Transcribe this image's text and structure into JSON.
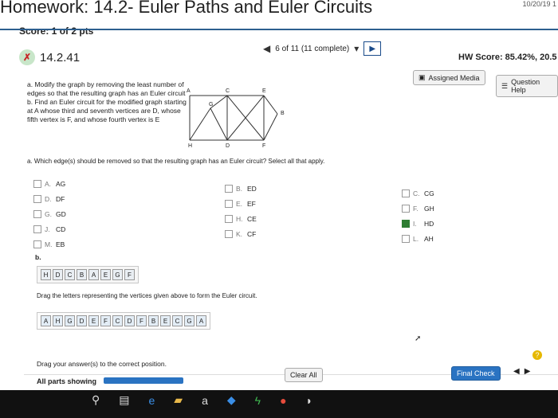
{
  "title": "Homework: 14.2- Euler Paths and Euler Circuits",
  "corner_date": "10/20/19 1",
  "score": "Score: 1 of 2 pts",
  "nav": {
    "progress_text": "6 of 11 (11 complete)",
    "prev_label": "◀",
    "next_label": "▶"
  },
  "question_number": "14.2.41",
  "hw_score": "HW Score: 85.42%, 20.5",
  "buttons": {
    "assigned_media": "Assigned Media",
    "question_help": "Question Help",
    "clear_all": "Clear All",
    "final_check": "Final Check"
  },
  "problem": {
    "a": "a. Modify the graph by removing the least number of edges so that the resulting graph has an Euler circuit",
    "b": "b. Find an Euler circuit for the modified graph starting at A whose third and seventh vertices are D, whose fifth vertex is F, and whose fourth vertex is E"
  },
  "graph_labels": [
    "A",
    "C",
    "E",
    "G",
    "B",
    "H",
    "D",
    "F"
  ],
  "question_a": "a. Which edge(s) should be removed so that the resulting graph has an Euler circuit? Select all that apply.",
  "options": [
    {
      "letter": "A.",
      "text": "AG",
      "checked": false
    },
    {
      "letter": "D.",
      "text": "DF",
      "checked": false
    },
    {
      "letter": "G.",
      "text": "GD",
      "checked": false
    },
    {
      "letter": "J.",
      "text": "CD",
      "checked": false
    },
    {
      "letter": "M.",
      "text": "EB",
      "checked": false
    },
    {
      "letter": "B.",
      "text": "ED",
      "checked": false
    },
    {
      "letter": "E.",
      "text": "EF",
      "checked": false
    },
    {
      "letter": "H.",
      "text": "CE",
      "checked": false
    },
    {
      "letter": "K.",
      "text": "CF",
      "checked": false
    },
    {
      "letter": "C.",
      "text": "CG",
      "checked": false
    },
    {
      "letter": "F.",
      "text": "GH",
      "checked": false
    },
    {
      "letter": "I.",
      "text": "HD",
      "checked": true
    },
    {
      "letter": "L.",
      "text": "AH",
      "checked": false
    }
  ],
  "part_b_label": "b.",
  "vertex_tiles": [
    "H",
    "D",
    "C",
    "B",
    "A",
    "E",
    "G",
    "F"
  ],
  "drag_instruction": "Drag the letters representing the vertices given above to form the Euler circuit.",
  "answer_tiles": [
    "A",
    "H",
    "G",
    "D",
    "E",
    "F",
    "C",
    "D",
    "F",
    "B",
    "E",
    "C",
    "G",
    "A"
  ],
  "drag_answer": "Drag your answer(s) to the correct position.",
  "all_parts": "All parts showing",
  "help_icon": "?"
}
